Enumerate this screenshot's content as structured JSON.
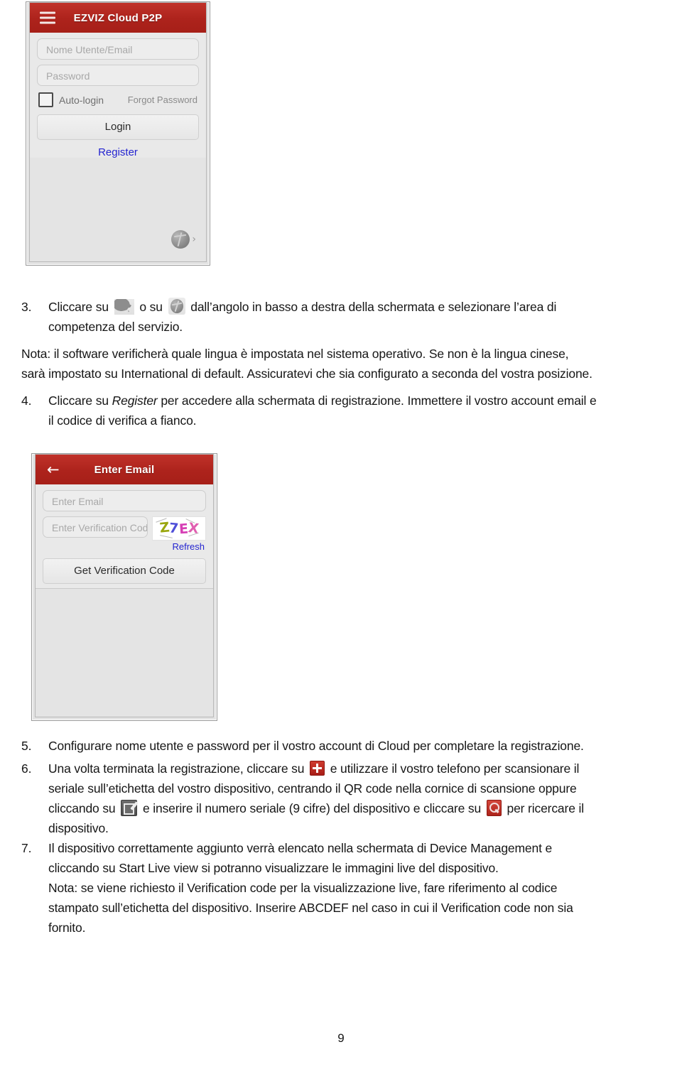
{
  "login_screenshot": {
    "name": "ezviz-login-screen",
    "title": "EZVIZ Cloud P2P",
    "menu_icon": "hamburger-menu-icon",
    "username_placeholder": "Nome Utente/Email",
    "password_placeholder": "Password",
    "autologin_label": "Auto-login",
    "forgot_password_label": "Forgot Password",
    "login_button_label": "Login",
    "register_link_label": "Register",
    "region_icon": "globe-icon",
    "region_chevron": "›",
    "header_color": "#ad231c",
    "link_color": "#2424d0"
  },
  "email_screenshot": {
    "name": "ezviz-enter-email-screen",
    "back_icon": "back-arrow-icon",
    "title": "Enter Email",
    "email_placeholder": "Enter Email",
    "verification_placeholder": "Enter Verification Code",
    "captcha_text": "Z7EX",
    "captcha_chars": [
      "Z",
      "7",
      "E",
      "X"
    ],
    "captcha_colors": [
      "#9aa60e",
      "#4f4fd8",
      "#d63fb5",
      "#e05fb0"
    ],
    "refresh_label": "Refresh",
    "get_code_button_label": "Get Verification Code",
    "header_color": "#ad231c"
  },
  "body": {
    "item3": {
      "number": "3.",
      "text_a": "Cliccare su",
      "icon_a": "china-map-icon",
      "text_b": "o su",
      "icon_b": "globe-icon",
      "text_c": "dall’angolo in basso a destra della schermata e selezionare l’area di",
      "line2": "competenza del servizio."
    },
    "note1": {
      "line1": "Nota: il software verificherà quale lingua è impostata nel sistema operativo. Se non è la lingua cinese,",
      "line2": "sarà impostato su International di default. Assicuratevi che sia configurato a seconda del vostra posizione."
    },
    "item4": {
      "number": "4.",
      "text_a": "Cliccare su",
      "emphasis": "Register",
      "text_b": "per accedere alla schermata di registrazione. Immettere il vostro account email e",
      "line2": "il codice di verifica a fianco."
    },
    "item5": {
      "number": "5.",
      "text": "Configurare nome utente e password per il vostro account di Cloud per completare la registrazione."
    },
    "item6": {
      "number": "6.",
      "text_a": "Una volta terminata la registrazione, cliccare su",
      "icon_a": "add-plus-icon",
      "text_b": "e utilizzare il vostro telefono per scansionare il",
      "line2": "seriale sull’etichetta del vostro dispositivo, centrando il QR code nella cornice di scansione oppure",
      "line3_a": "cliccando su",
      "icon_b": "edit-pencil-icon",
      "line3_b": "e inserire il numero seriale (9 cifre) del dispositivo e cliccare su",
      "icon_c": "search-icon",
      "line3_c": "per ricercare il",
      "line4": "dispositivo."
    },
    "item7": {
      "number": "7.",
      "line1": "Il dispositivo correttamente aggiunto verrà elencato nella schermata di Device Management e",
      "line2": "cliccando su Start Live view si potranno visualizzare le immagini live del dispositivo."
    },
    "note2": {
      "line1": "Nota: se viene richiesto il Verification code per la visualizzazione live, fare riferimento al codice",
      "line2": "stampato sull’etichetta del dispositivo. Inserire ABCDEF nel caso in cui il Verification code non sia",
      "line3": "fornito."
    }
  },
  "footer": {
    "page_number": "9"
  }
}
